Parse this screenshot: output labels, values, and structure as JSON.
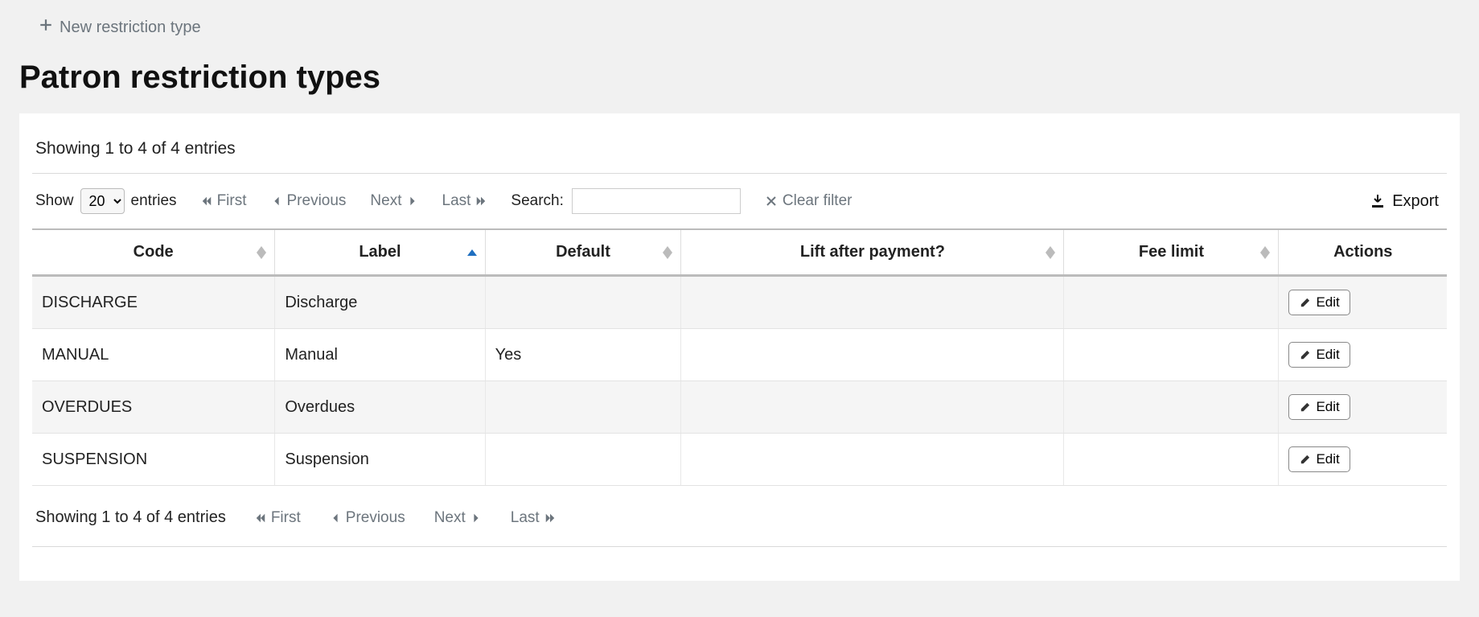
{
  "toolbar": {
    "new_label": "New restriction type"
  },
  "page": {
    "title": "Patron restriction types"
  },
  "datatable": {
    "info_top": "Showing 1 to 4 of 4 entries",
    "info_bottom": "Showing 1 to 4 of 4 entries",
    "length_prefix": "Show",
    "length_suffix": "entries",
    "length_value": "20",
    "pager": {
      "first": "First",
      "previous": "Previous",
      "next": "Next",
      "last": "Last"
    },
    "search_label": "Search:",
    "search_value": "",
    "clear_label": "Clear filter",
    "export_label": "Export",
    "columns": {
      "code": "Code",
      "label": "Label",
      "default": "Default",
      "lift": "Lift after payment?",
      "fee": "Fee limit",
      "actions": "Actions"
    },
    "sorted_column": "label",
    "sorted_dir": "asc",
    "edit_label": "Edit",
    "rows": [
      {
        "code": "DISCHARGE",
        "label": "Discharge",
        "default": "",
        "lift": "",
        "fee": ""
      },
      {
        "code": "MANUAL",
        "label": "Manual",
        "default": "Yes",
        "lift": "",
        "fee": ""
      },
      {
        "code": "OVERDUES",
        "label": "Overdues",
        "default": "",
        "lift": "",
        "fee": ""
      },
      {
        "code": "SUSPENSION",
        "label": "Suspension",
        "default": "",
        "lift": "",
        "fee": ""
      }
    ]
  }
}
